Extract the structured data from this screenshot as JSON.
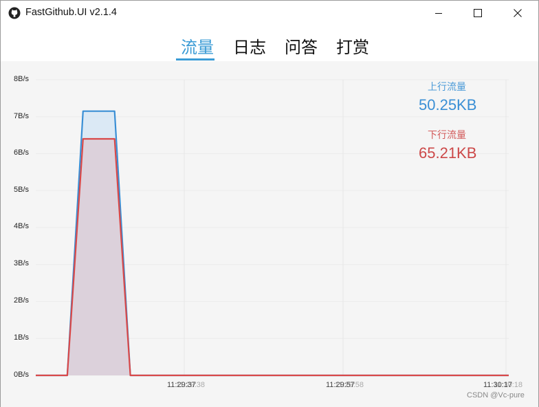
{
  "window": {
    "title": "FastGithub.UI v2.1.4",
    "app_icon": "github-cat-icon",
    "controls": {
      "minimize_icon": "minimize-icon",
      "maximize_icon": "maximize-icon",
      "close_icon": "close-icon"
    }
  },
  "tabs": [
    {
      "label": "流量",
      "active": true
    },
    {
      "label": "日志",
      "active": false
    },
    {
      "label": "问答",
      "active": false
    },
    {
      "label": "打赏",
      "active": false
    }
  ],
  "colors": {
    "accent": "#3a9bd5",
    "upload": "#3a8fd5",
    "upload_fill": "#d6e6f5",
    "download": "#d94848",
    "download_fill": "#dccdd6"
  },
  "legend": {
    "upload_label": "上行流量",
    "upload_value": "50.25KB",
    "download_label": "下行流量",
    "download_value": "65.21KB"
  },
  "chart_data": {
    "type": "area",
    "title": "",
    "xlabel": "",
    "ylabel": "",
    "y_tick_labels": [
      "0B/s",
      "1B/s",
      "2B/s",
      "3B/s",
      "4B/s",
      "5B/s",
      "6B/s",
      "7B/s",
      "8B/s"
    ],
    "ylim": [
      0,
      8
    ],
    "grid": true,
    "x_tick_labels": [
      {
        "label": "11:29:37",
        "ghost": "11:29:38"
      },
      {
        "label": "11:29:57",
        "ghost": "11:29:58"
      },
      {
        "label": "11:30:17",
        "ghost": "11:30:18"
      }
    ],
    "series": [
      {
        "name": "上行流量",
        "points": [
          [
            0,
            0
          ],
          [
            4,
            0
          ],
          [
            6,
            7.15
          ],
          [
            10,
            7.15
          ],
          [
            12,
            0
          ],
          [
            60,
            0
          ]
        ]
      },
      {
        "name": "下行流量",
        "points": [
          [
            0,
            0
          ],
          [
            4,
            0
          ],
          [
            6,
            6.4
          ],
          [
            10,
            6.4
          ],
          [
            12,
            0
          ],
          [
            60,
            0
          ]
        ]
      }
    ]
  },
  "watermark": "CSDN @Vc-pure"
}
